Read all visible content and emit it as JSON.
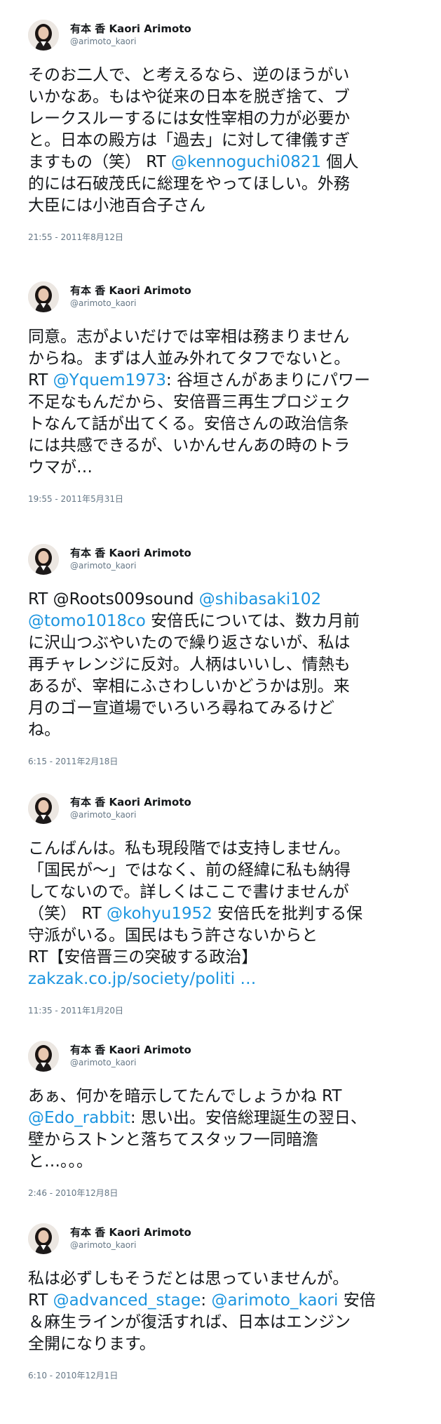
{
  "author": {
    "display_name": "有本 香 Kaori Arimoto",
    "handle": "@arimoto_kaori"
  },
  "tweets": [
    {
      "lines": [
        [
          {
            "t": "そのお二人で、と考えるなら、逆のほうがい"
          }
        ],
        [
          {
            "t": "いかなあ。もはや従来の日本を脱ぎ捨て、ブ"
          }
        ],
        [
          {
            "t": "レークスルーするには女性宰相の力が必要か"
          }
        ],
        [
          {
            "t": "と。日本の殿方は「過去」に対して律儀すぎ"
          }
        ],
        [
          {
            "t": "ますもの（笑） RT "
          },
          {
            "t": "@kennoguchi0821",
            "link": true
          },
          {
            "t": " 個人"
          }
        ],
        [
          {
            "t": "的には石破茂氏に総理をやってほしい。外務"
          }
        ],
        [
          {
            "t": "大臣には小池百合子さん"
          }
        ]
      ],
      "timestamp": "21:55 - 2011年8月12日"
    },
    {
      "lines": [
        [
          {
            "t": "同意。志がよいだけでは宰相は務まりません"
          }
        ],
        [
          {
            "t": "からね。まずは人並み外れてタフでないと。"
          }
        ],
        [
          {
            "t": "RT "
          },
          {
            "t": "@Yquem1973",
            "link": true
          },
          {
            "t": ": 谷垣さんがあまりにパワー"
          }
        ],
        [
          {
            "t": "不足なもんだから、安倍晋三再生プロジェク"
          }
        ],
        [
          {
            "t": "トなんて話が出てくる。安倍さんの政治信条"
          }
        ],
        [
          {
            "t": "には共感できるが、いかんせんあの時のトラ"
          }
        ],
        [
          {
            "t": "ウマが…"
          }
        ]
      ],
      "timestamp": "19:55 - 2011年5月31日"
    },
    {
      "lines": [
        [
          {
            "t": "RT @Roots009sound "
          },
          {
            "t": "@shibasaki102",
            "link": true
          }
        ],
        [
          {
            "t": "@tomo1018co",
            "link": true
          },
          {
            "t": " 安倍氏については、数カ月前"
          }
        ],
        [
          {
            "t": "に沢山つぶやいたので繰り返さないが、私は"
          }
        ],
        [
          {
            "t": "再チャレンジに反対。人柄はいいし、情熱も"
          }
        ],
        [
          {
            "t": "あるが、宰相にふさわしいかどうかは別。来"
          }
        ],
        [
          {
            "t": "月のゴー宣道場でいろいろ尋ねてみるけど"
          }
        ],
        [
          {
            "t": "ね。"
          }
        ]
      ],
      "timestamp": "6:15 - 2011年2月18日"
    },
    {
      "lines": [
        [
          {
            "t": "こんばんは。私も現段階では支持しません。"
          }
        ],
        [
          {
            "t": "「国民が～」ではなく、前の経緯に私も納得"
          }
        ],
        [
          {
            "t": "してないので。詳しくはここで書けませんが"
          }
        ],
        [
          {
            "t": "（笑） RT "
          },
          {
            "t": "@kohyu1952",
            "link": true
          },
          {
            "t": " 安倍氏を批判する保"
          }
        ],
        [
          {
            "t": "守派がいる。国民はもう許さないからと"
          }
        ],
        [
          {
            "t": "RT【安倍晋三の突破する政治】"
          }
        ],
        [
          {
            "t": "zakzak.co.jp/society/politi …",
            "link": true
          }
        ]
      ],
      "timestamp": "11:35 - 2011年1月20日"
    },
    {
      "lines": [
        [
          {
            "t": "あぁ、何かを暗示してたんでしょうかね RT"
          }
        ],
        [
          {
            "t": "@Edo_rabbit",
            "link": true
          },
          {
            "t": ": 思い出。安倍総理誕生の翌日、"
          }
        ],
        [
          {
            "t": "壁からストンと落ちてスタッフ一同暗澹"
          }
        ],
        [
          {
            "t": "と…。。。"
          }
        ]
      ],
      "timestamp": "2:46 - 2010年12月8日"
    },
    {
      "lines": [
        [
          {
            "t": "私は必ずしもそうだとは思っていませんが。"
          }
        ],
        [
          {
            "t": "RT "
          },
          {
            "t": "@advanced_stage",
            "link": true
          },
          {
            "t": ": "
          },
          {
            "t": "@arimoto_kaori",
            "link": true
          },
          {
            "t": " 安倍"
          }
        ],
        [
          {
            "t": "＆麻生ラインが復活すれば、日本はエンジン"
          }
        ],
        [
          {
            "t": "全開になります。"
          }
        ]
      ],
      "timestamp": "6:10 - 2010年12月1日"
    }
  ]
}
